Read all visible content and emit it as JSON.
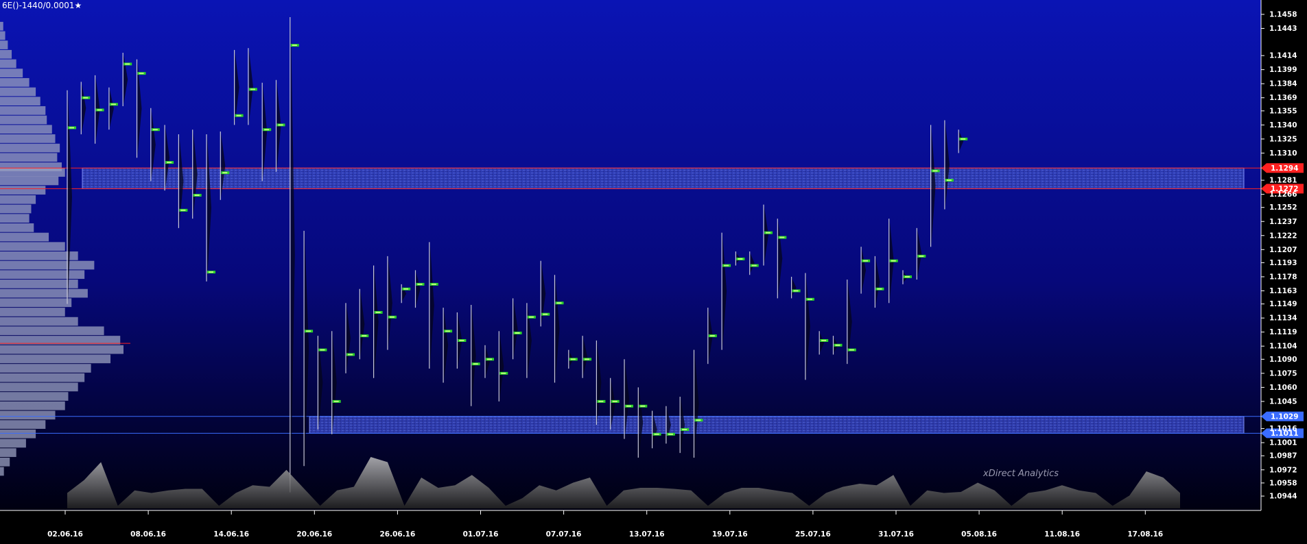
{
  "header": {
    "symbol": "6E()-1440/0.0001",
    "star": "★"
  },
  "brand": "xDirect Analytics",
  "colors": {
    "bg_top": "#0a14b4",
    "bg_bottom": "#000010",
    "zone": "#3b4cc4",
    "resistance": "#ff2020",
    "support": "#3a6cff",
    "volume_profile": "#9aa0c0",
    "cluster": "#2bd12b",
    "poc": "#c0ff80"
  },
  "chart_data": {
    "type": "candlestick",
    "instrument": "6E()-1440/0.0001",
    "ylim": [
      1.0936,
      1.1466
    ],
    "y_ticks": [
      1.1458,
      1.1443,
      1.1414,
      1.1399,
      1.1384,
      1.1369,
      1.1355,
      1.134,
      1.1325,
      1.131,
      1.1281,
      1.1266,
      1.1252,
      1.1237,
      1.1222,
      1.1207,
      1.1193,
      1.1178,
      1.1163,
      1.1149,
      1.1134,
      1.1119,
      1.1104,
      1.109,
      1.1075,
      1.106,
      1.1045,
      1.1016,
      1.1001,
      1.0987,
      1.0972,
      1.0958,
      1.0944
    ],
    "highlight_levels": [
      {
        "value": 1.1294,
        "label": "1.1294",
        "kind": "resistance"
      },
      {
        "value": 1.1272,
        "label": "1.1272",
        "kind": "resistance"
      },
      {
        "value": 1.1029,
        "label": "1.1029",
        "kind": "support"
      },
      {
        "value": 1.1011,
        "label": "1.1011",
        "kind": "support"
      }
    ],
    "zones": [
      {
        "from": 1.1272,
        "to": 1.1294,
        "start_bar": 0
      },
      {
        "from": 1.1011,
        "to": 1.1029,
        "start_bar": 17
      }
    ],
    "x_labels": [
      "02.06.16",
      "08.06.16",
      "14.06.16",
      "20.06.16",
      "26.06.16",
      "01.07.16",
      "07.07.16",
      "13.07.16",
      "19.07.16",
      "25.07.16",
      "31.07.16",
      "05.08.16",
      "11.08.16",
      "17.08.16"
    ],
    "bars": [
      {
        "h": 1.1377,
        "l": 1.1149,
        "poc": 1.1337
      },
      {
        "h": 1.1386,
        "l": 1.133,
        "poc": 1.1369
      },
      {
        "h": 1.1393,
        "l": 1.132,
        "poc": 1.1356
      },
      {
        "h": 1.138,
        "l": 1.1335,
        "poc": 1.1362
      },
      {
        "h": 1.1417,
        "l": 1.136,
        "poc": 1.1405
      },
      {
        "h": 1.141,
        "l": 1.1305,
        "poc": 1.1395
      },
      {
        "h": 1.1358,
        "l": 1.128,
        "poc": 1.1335
      },
      {
        "h": 1.134,
        "l": 1.127,
        "poc": 1.13
      },
      {
        "h": 1.133,
        "l": 1.123,
        "poc": 1.1249
      },
      {
        "h": 1.1335,
        "l": 1.124,
        "poc": 1.1265
      },
      {
        "h": 1.133,
        "l": 1.1173,
        "poc": 1.1183
      },
      {
        "h": 1.1333,
        "l": 1.126,
        "poc": 1.1289
      },
      {
        "h": 1.142,
        "l": 1.134,
        "poc": 1.135
      },
      {
        "h": 1.1422,
        "l": 1.134,
        "poc": 1.1378
      },
      {
        "h": 1.1385,
        "l": 1.128,
        "poc": 1.1335
      },
      {
        "h": 1.1388,
        "l": 1.129,
        "poc": 1.134
      },
      {
        "h": 1.1455,
        "l": 1.0948,
        "poc": 1.1425
      },
      {
        "h": 1.1227,
        "l": 1.0976,
        "poc": 1.112
      },
      {
        "h": 1.1115,
        "l": 1.1015,
        "poc": 1.11
      },
      {
        "h": 1.112,
        "l": 1.101,
        "poc": 1.1045
      },
      {
        "h": 1.115,
        "l": 1.1075,
        "poc": 1.1095
      },
      {
        "h": 1.1165,
        "l": 1.109,
        "poc": 1.1115
      },
      {
        "h": 1.119,
        "l": 1.107,
        "poc": 1.114
      },
      {
        "h": 1.12,
        "l": 1.11,
        "poc": 1.1135
      },
      {
        "h": 1.117,
        "l": 1.115,
        "poc": 1.1165
      },
      {
        "h": 1.1185,
        "l": 1.1145,
        "poc": 1.117
      },
      {
        "h": 1.1215,
        "l": 1.108,
        "poc": 1.117
      },
      {
        "h": 1.1145,
        "l": 1.1065,
        "poc": 1.112
      },
      {
        "h": 1.114,
        "l": 1.108,
        "poc": 1.111
      },
      {
        "h": 1.1148,
        "l": 1.104,
        "poc": 1.1085
      },
      {
        "h": 1.1105,
        "l": 1.107,
        "poc": 1.109
      },
      {
        "h": 1.112,
        "l": 1.1045,
        "poc": 1.1075
      },
      {
        "h": 1.1155,
        "l": 1.109,
        "poc": 1.1118
      },
      {
        "h": 1.115,
        "l": 1.107,
        "poc": 1.1135
      },
      {
        "h": 1.1195,
        "l": 1.1125,
        "poc": 1.1138
      },
      {
        "h": 1.118,
        "l": 1.1065,
        "poc": 1.115
      },
      {
        "h": 1.11,
        "l": 1.108,
        "poc": 1.109
      },
      {
        "h": 1.1115,
        "l": 1.107,
        "poc": 1.109
      },
      {
        "h": 1.111,
        "l": 1.102,
        "poc": 1.1045
      },
      {
        "h": 1.107,
        "l": 1.1015,
        "poc": 1.1045
      },
      {
        "h": 1.109,
        "l": 1.1005,
        "poc": 1.104
      },
      {
        "h": 1.106,
        "l": 1.0985,
        "poc": 1.104
      },
      {
        "h": 1.1035,
        "l": 1.0995,
        "poc": 1.101
      },
      {
        "h": 1.104,
        "l": 1.1,
        "poc": 1.101
      },
      {
        "h": 1.105,
        "l": 1.099,
        "poc": 1.1015
      },
      {
        "h": 1.11,
        "l": 1.0985,
        "poc": 1.1025
      },
      {
        "h": 1.1145,
        "l": 1.1085,
        "poc": 1.1115
      },
      {
        "h": 1.1225,
        "l": 1.11,
        "poc": 1.119
      },
      {
        "h": 1.1205,
        "l": 1.119,
        "poc": 1.1197
      },
      {
        "h": 1.1205,
        "l": 1.118,
        "poc": 1.119
      },
      {
        "h": 1.1255,
        "l": 1.119,
        "poc": 1.1225
      },
      {
        "h": 1.124,
        "l": 1.1155,
        "poc": 1.122
      },
      {
        "h": 1.1178,
        "l": 1.1155,
        "poc": 1.1163
      },
      {
        "h": 1.1182,
        "l": 1.1068,
        "poc": 1.1154
      },
      {
        "h": 1.112,
        "l": 1.1095,
        "poc": 1.111
      },
      {
        "h": 1.1115,
        "l": 1.1095,
        "poc": 1.1105
      },
      {
        "h": 1.1175,
        "l": 1.1085,
        "poc": 1.11
      },
      {
        "h": 1.121,
        "l": 1.116,
        "poc": 1.1195
      },
      {
        "h": 1.12,
        "l": 1.1145,
        "poc": 1.1165
      },
      {
        "h": 1.124,
        "l": 1.115,
        "poc": 1.1195
      },
      {
        "h": 1.1185,
        "l": 1.117,
        "poc": 1.1178
      },
      {
        "h": 1.123,
        "l": 1.1175,
        "poc": 1.12
      },
      {
        "h": 1.134,
        "l": 1.121,
        "poc": 1.1291
      },
      {
        "h": 1.1345,
        "l": 1.125,
        "poc": 1.1281
      },
      {
        "h": 1.1335,
        "l": 1.131,
        "poc": 1.1325
      }
    ],
    "volume_profile_left": [
      {
        "p": 1.145,
        "w": 5
      },
      {
        "p": 1.144,
        "w": 8
      },
      {
        "p": 1.143,
        "w": 12
      },
      {
        "p": 1.142,
        "w": 18
      },
      {
        "p": 1.141,
        "w": 25
      },
      {
        "p": 1.14,
        "w": 35
      },
      {
        "p": 1.139,
        "w": 45
      },
      {
        "p": 1.138,
        "w": 55
      },
      {
        "p": 1.137,
        "w": 62
      },
      {
        "p": 1.136,
        "w": 70
      },
      {
        "p": 1.135,
        "w": 72
      },
      {
        "p": 1.134,
        "w": 80
      },
      {
        "p": 1.133,
        "w": 85
      },
      {
        "p": 1.132,
        "w": 92
      },
      {
        "p": 1.131,
        "w": 88
      },
      {
        "p": 1.13,
        "w": 95
      },
      {
        "p": 1.1294,
        "w": 100
      },
      {
        "p": 1.1285,
        "w": 90
      },
      {
        "p": 1.1275,
        "w": 70
      },
      {
        "p": 1.1265,
        "w": 55
      },
      {
        "p": 1.1255,
        "w": 48
      },
      {
        "p": 1.1245,
        "w": 45
      },
      {
        "p": 1.1235,
        "w": 52
      },
      {
        "p": 1.1225,
        "w": 75
      },
      {
        "p": 1.1215,
        "w": 100
      },
      {
        "p": 1.1205,
        "w": 120
      },
      {
        "p": 1.1195,
        "w": 145
      },
      {
        "p": 1.1185,
        "w": 130
      },
      {
        "p": 1.1175,
        "w": 120
      },
      {
        "p": 1.1165,
        "w": 135
      },
      {
        "p": 1.1155,
        "w": 110
      },
      {
        "p": 1.1145,
        "w": 100
      },
      {
        "p": 1.1135,
        "w": 120
      },
      {
        "p": 1.1125,
        "w": 160
      },
      {
        "p": 1.1115,
        "w": 185
      },
      {
        "p": 1.1105,
        "w": 190
      },
      {
        "p": 1.1095,
        "w": 170
      },
      {
        "p": 1.1085,
        "w": 140
      },
      {
        "p": 1.1075,
        "w": 130
      },
      {
        "p": 1.1065,
        "w": 120
      },
      {
        "p": 1.1055,
        "w": 105
      },
      {
        "p": 1.1045,
        "w": 100
      },
      {
        "p": 1.1035,
        "w": 85
      },
      {
        "p": 1.1025,
        "w": 70
      },
      {
        "p": 1.1015,
        "w": 55
      },
      {
        "p": 1.1005,
        "w": 40
      },
      {
        "p": 1.0995,
        "w": 25
      },
      {
        "p": 1.0985,
        "w": 15
      },
      {
        "p": 1.0975,
        "w": 6
      }
    ],
    "volume_profile_poc": 1.1107,
    "volume_histogram": [
      0.3,
      0.55,
      0.9,
      0.05,
      0.35,
      0.3,
      0.35,
      0.38,
      0.38,
      0.05,
      0.3,
      0.45,
      0.42,
      0.75,
      0.4,
      0.05,
      0.35,
      0.42,
      1.0,
      0.9,
      0.05,
      0.6,
      0.4,
      0.45,
      0.65,
      0.4,
      0.05,
      0.2,
      0.45,
      0.35,
      0.5,
      0.6,
      0.05,
      0.35,
      0.4,
      0.4,
      0.38,
      0.35,
      0.05,
      0.3,
      0.4,
      0.4,
      0.35,
      0.3,
      0.05,
      0.3,
      0.42,
      0.48,
      0.45,
      0.65,
      0.05,
      0.35,
      0.3,
      0.32,
      0.5,
      0.35,
      0.05,
      0.3,
      0.35,
      0.45,
      0.35,
      0.3,
      0.05,
      0.25,
      0.72,
      0.6,
      0.3
    ]
  }
}
